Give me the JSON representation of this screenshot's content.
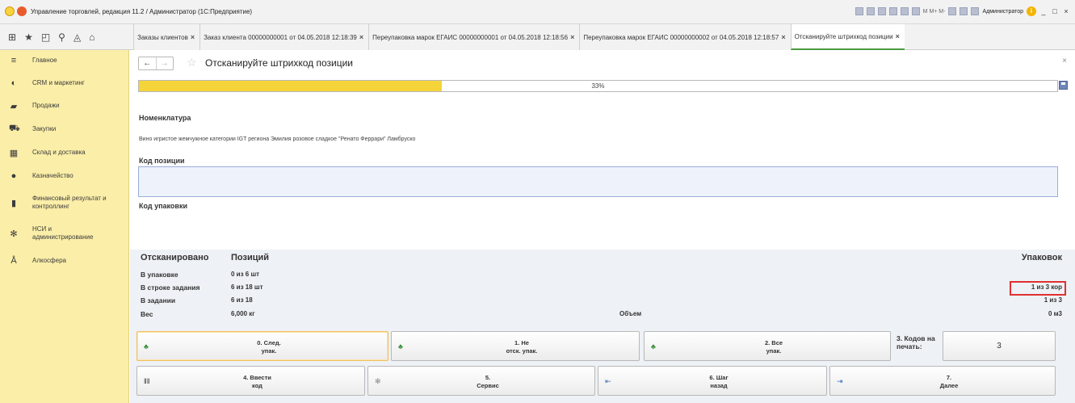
{
  "window": {
    "title": "Управление торговлей, редакция 11.2 / Администратор (1С:Предприятие)",
    "toolbar_text": "M  M+  M-",
    "user": "Администратор",
    "win_controls": [
      "_",
      "□",
      "×"
    ]
  },
  "tabs": [
    {
      "label": "Заказы клиентов",
      "close": "×"
    },
    {
      "label": "Заказ клиента 00000000001 от 04.05.2018 12:18:39",
      "close": "×"
    },
    {
      "label": "Переупаковка марок ЕГАИС 00000000001 от 04.05.2018 12:18:56",
      "close": "×"
    },
    {
      "label": "Переупаковка марок ЕГАИС 00000000002 от 04.05.2018 12:18:57",
      "close": "×"
    },
    {
      "label": "Отсканируйте штрихкод позиции",
      "close": "×",
      "active": true
    }
  ],
  "sidebar": {
    "items": [
      {
        "label": "Главное",
        "icon": "menu-icon"
      },
      {
        "label": "CRM и маркетинг",
        "icon": "crm-icon"
      },
      {
        "label": "Продажи",
        "icon": "sales-bag-icon"
      },
      {
        "label": "Закупки",
        "icon": "cart-icon"
      },
      {
        "label": "Склад и доставка",
        "icon": "warehouse-icon"
      },
      {
        "label": "Казначейство",
        "icon": "treasury-icon"
      },
      {
        "label": "Финансовый результат и контроллинг",
        "icon": "chart-icon"
      },
      {
        "label": "НСИ и администрирование",
        "icon": "gear-icon"
      },
      {
        "label": "Алкосфера",
        "icon": "alcosphere-icon"
      }
    ]
  },
  "page": {
    "title": "Отсканируйте штрихкод позиции",
    "progress_label": "33%",
    "progress_fraction": 0.33,
    "nomenclature_label": "Номенклатура",
    "nomenclature_value": "Вино игристое жемчужное категории IGT региона Эмилия розовое сладкое \"Ренато Феррари\" Ламбруско",
    "position_code_label": "Код позиции",
    "position_code_value": "",
    "package_code_label": "Код упаковки"
  },
  "stats": {
    "head": {
      "c1": "Отсканировано",
      "c2": "Позиций",
      "right": "Упаковок"
    },
    "rows": [
      {
        "c1": "В упаковке",
        "c2": "0 из 6 шт",
        "right": ""
      },
      {
        "c1": "В строке задания",
        "c2": "6 из 18 шт",
        "right": "1 из 3 кор"
      },
      {
        "c1": "В задании",
        "c2": "6 из 18",
        "right": "1 из 3"
      },
      {
        "c1": "Вес",
        "c2": "6,000 кг",
        "c3": "Объем",
        "right": "0 м3"
      }
    ]
  },
  "actions": {
    "row1": [
      {
        "label": "0. След.\nупак.",
        "icon": "box-arrow-icon"
      },
      {
        "label": "1. Не\nотск. упак.",
        "icon": "box-arrow-icon"
      },
      {
        "label": "2. Все\nупак.",
        "icon": "box-arrow-icon"
      }
    ],
    "codes_label": "3. Кодов на\nпечать:",
    "codes_value": "3",
    "row2": [
      {
        "label": "4. Ввести\nкод",
        "icon": "barcode-icon"
      },
      {
        "label": "5.\nСервис",
        "icon": "gear-icon"
      },
      {
        "label": "6. Шаг\nназад",
        "icon": "back-icon"
      },
      {
        "label": "7.\nДалее",
        "icon": "next-icon"
      }
    ]
  }
}
